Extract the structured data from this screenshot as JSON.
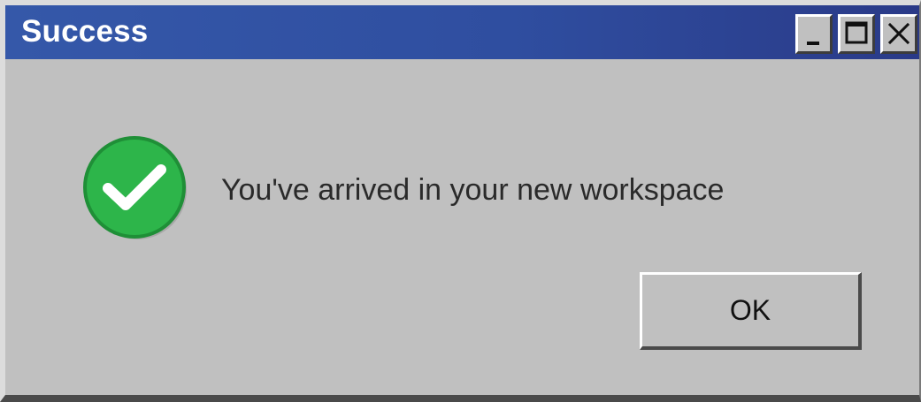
{
  "window": {
    "title": "Success"
  },
  "controls": {
    "minimize_icon": "minimize-icon",
    "maximize_icon": "maximize-icon",
    "close_icon": "close-icon"
  },
  "dialog": {
    "icon": "success-check-icon",
    "message": "You've arrived in your new workspace",
    "ok_label": "OK"
  },
  "colors": {
    "titlebar_start": "#3558a9",
    "titlebar_end": "#2a3a88",
    "window_bg": "#c0c0c0",
    "success_green": "#2db54a"
  }
}
